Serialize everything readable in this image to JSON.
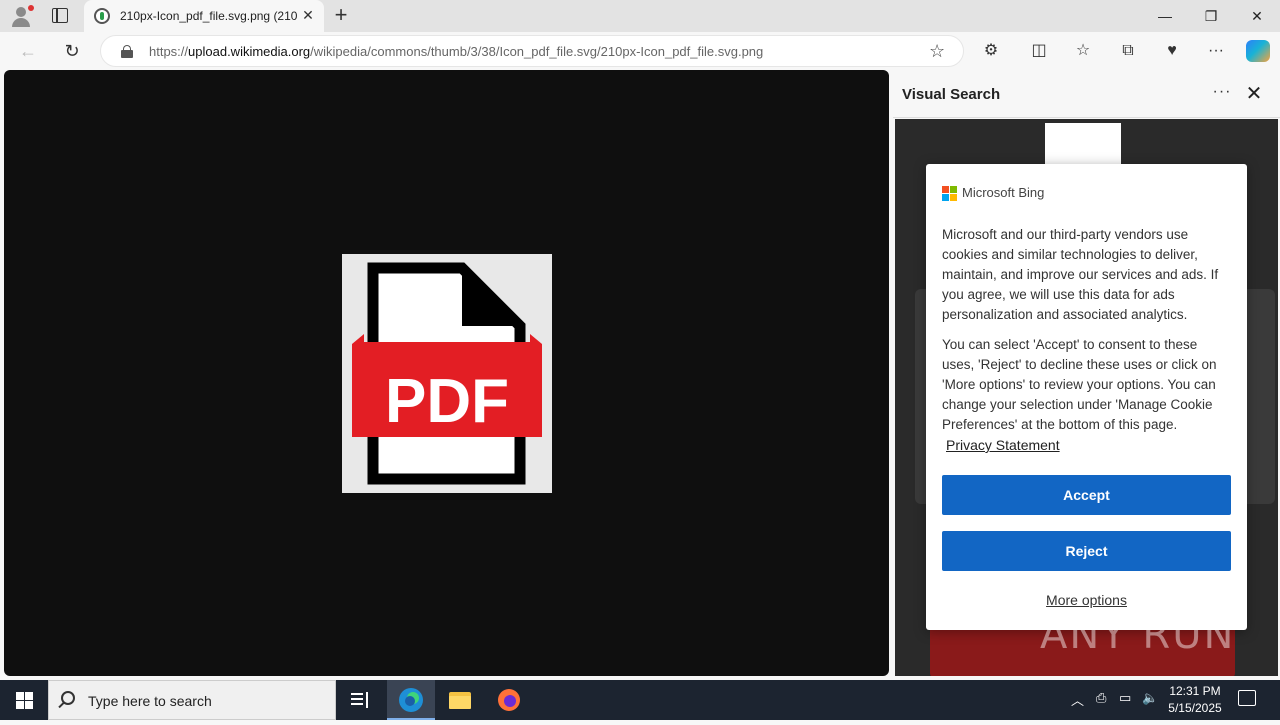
{
  "browser": {
    "tab_title": "210px-Icon_pdf_file.svg.png (210",
    "tab_close": "✕",
    "new_tab": "+",
    "window_controls": {
      "minimize": "—",
      "restore": "❐",
      "close": "✕"
    },
    "url_prefix": "https://",
    "url_host": "upload.wikimedia.org",
    "url_path": "/wikipedia/commons/thumb/3/38/Icon_pdf_file.svg/210px-Icon_pdf_file.svg.png",
    "back": "←",
    "refresh": "↻",
    "favorite_star": "☆",
    "toolbar": {
      "extensions": "⚙",
      "split": "◫",
      "favorites": "☆",
      "collections": "⧉",
      "performance": "♥",
      "more": "···"
    }
  },
  "viewer": {
    "image_text": "PDF",
    "colors": {
      "background": "#0f0f0f",
      "pdf_red": "#e31e24"
    }
  },
  "panel": {
    "title": "Visual Search",
    "more": "···",
    "close": "✕"
  },
  "dialog": {
    "brand": "Microsoft Bing",
    "paragraph1": "Microsoft and our third-party vendors use cookies and similar technologies to deliver, maintain, and improve our services and ads. If you agree, we will use this data for ads personalization and associated analytics.",
    "paragraph2": "You can select 'Accept' to consent to these uses, 'Reject' to decline these uses or click on 'More options' to review your options. You can change your selection under 'Manage Cookie Preferences' at the bottom of this page.",
    "privacy_link": "Privacy Statement",
    "accept": "Accept",
    "reject": "Reject",
    "more_options": "More options",
    "colors": {
      "button": "#1266c4"
    }
  },
  "watermark": "ANY RUN",
  "taskbar": {
    "search_placeholder": "Type here to search",
    "time": "12:31 PM",
    "date": "5/15/2025"
  }
}
